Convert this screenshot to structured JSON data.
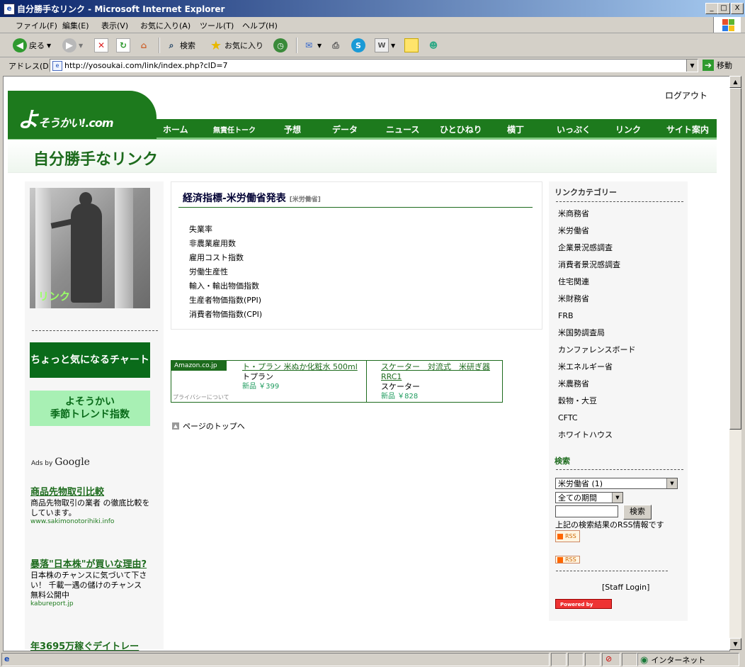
{
  "window": {
    "title": "自分勝手なリンク - Microsoft Internet Explorer",
    "minimize": "_",
    "maximize": "□",
    "close": "X"
  },
  "menu": [
    "ファイル(F)",
    "編集(E)",
    "表示(V)",
    "お気に入り(A)",
    "ツール(T)",
    "ヘルプ(H)"
  ],
  "toolbar": {
    "back": "戻る",
    "search": "検索",
    "favorites": "お気に入り"
  },
  "address": {
    "label": "アドレス(D)",
    "url": "http://yosoukai.com/link/index.php?cID=7",
    "go": "移動"
  },
  "site": {
    "logout": "ログアウト",
    "logo": "よ",
    "logo_rest": "そうかい!",
    "logo_com": ".com",
    "nav": [
      "ホーム",
      "無責任トーク",
      "予想",
      "データ",
      "ニュース",
      "ひとひねり",
      "横丁",
      "いっぷく",
      "リンク",
      "サイト案内"
    ],
    "page_title": "自分勝手なリンク"
  },
  "left": {
    "image_label": "リンク",
    "banner1": "ちょっと気になるチャート",
    "banner2_line1": "よそうかい",
    "banner2_line2": "季節トレンド指数",
    "ads_by": "Ads by",
    "ads_google": "Google",
    "ads": [
      {
        "title": "商品先物取引比較",
        "desc": "商品先物取引の業者 の徹底比較をしています。",
        "url": "www.sakimonotorihiki.info"
      },
      {
        "title": "暴落\"日本株\"が買いな理由?",
        "desc": "日本株のチャンスに気づいて下さい！ 千載一遇の儲けのチャンス 無料公開中",
        "url": "kabureport.jp"
      },
      {
        "title": "年3695万稼ぐデイトレー",
        "desc": "",
        "url": ""
      }
    ]
  },
  "main": {
    "heading": "経済指標-米労働省発表",
    "heading_tag": "[米労働省]",
    "items": [
      "失業率",
      "非農業雇用数",
      "雇用コスト指数",
      "労働生産性",
      "輸入・輸出物価指数",
      "生産者物価指数(PPI)",
      "消費者物価指数(CPI)"
    ],
    "amazon": {
      "tag": "Amazon.co.jp",
      "privacy": "プライバシーについて",
      "item1_title": "ト・プラン 米ぬか化粧水 500ml",
      "item1_maker": "トプラン",
      "item1_price": "新品 ￥399",
      "item2_title": "スケーター　対流式　米研ぎ器 RRC1",
      "item2_maker": "スケーター",
      "item2_price": "新品 ￥828"
    },
    "to_top": "ページのトップへ"
  },
  "right": {
    "category_heading": "リンクカテゴリー",
    "categories": [
      "米商務省",
      "米労働省",
      "企業景況感調査",
      "消費者景況感調査",
      "住宅関連",
      "米財務省",
      "FRB",
      "米国勢調査局",
      "カンファレンスボード",
      "米エネルギー省",
      "米農務省",
      "穀物・大豆",
      "CFTC",
      "ホワイトハウス"
    ],
    "search_heading": "検索",
    "category_select": "米労働省 (1)",
    "period_select": "全ての期間",
    "search_button": "検索",
    "rss_note": "上記の検索結果のRSS情報です",
    "rss": "RSS",
    "staff_login": "[Staff Login]",
    "powered": "Powered by"
  },
  "status": {
    "zone": "インターネット"
  }
}
